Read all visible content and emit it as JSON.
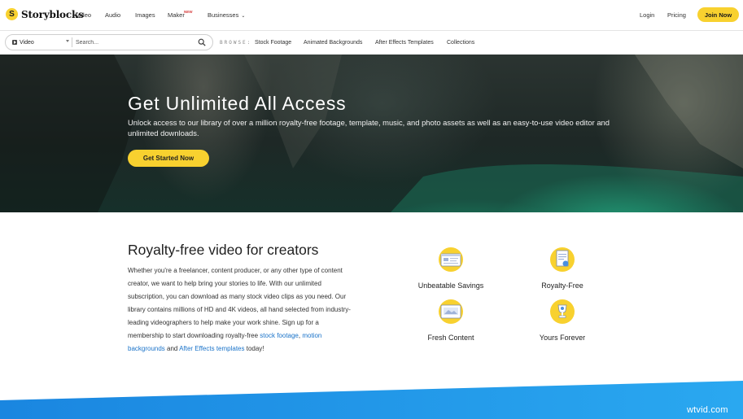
{
  "brand": {
    "name": "Storyblocks",
    "mark": "S"
  },
  "nav": {
    "links": [
      "Video",
      "Audio",
      "Images",
      "Maker",
      "Businesses"
    ],
    "maker_badge": "NEW",
    "login": "Login",
    "pricing": "Pricing",
    "join": "Join Now"
  },
  "search": {
    "type_value": "Video",
    "placeholder": "Search...",
    "browse_label": "BROWSE:",
    "browse_links": [
      "Stock Footage",
      "Animated Backgrounds",
      "After Effects Templates",
      "Collections"
    ]
  },
  "hero": {
    "title": "Get Unlimited All Access",
    "subtitle": "Unlock access to our library of over a million royalty-free footage, template, music, and photo assets as well as an easy-to-use video editor and unlimited downloads.",
    "cta": "Get Started Now"
  },
  "content": {
    "title": "Royalty-free video for creators",
    "body_pre": "Whether you're a freelancer, content producer, or any other type of content creator, we want to help bring your stories to life. With our unlimited subscription, you can download as many stock video clips as you need. Our library contains millions of HD and 4K videos, all hand selected from industry-leading videographers to help make your work shine. Sign up for a membership to start downloading royalty-free ",
    "link_stock_footage": "stock footage",
    "sep": ", ",
    "link_motion_backgrounds": "motion backgrounds",
    "and": " and ",
    "link_ae_templates": "After Effects templates",
    "body_post": " today!"
  },
  "features": [
    {
      "label": "Unbeatable Savings",
      "icon": "savings-icon"
    },
    {
      "label": "Royalty-Free",
      "icon": "document-icon"
    },
    {
      "label": "Fresh Content",
      "icon": "content-icon"
    },
    {
      "label": "Yours Forever",
      "icon": "trophy-icon"
    }
  ],
  "watermark": "wtvid.com",
  "colors": {
    "accent": "#f8d12f",
    "link": "#1a73c9",
    "wave": "#1e8fe6"
  }
}
